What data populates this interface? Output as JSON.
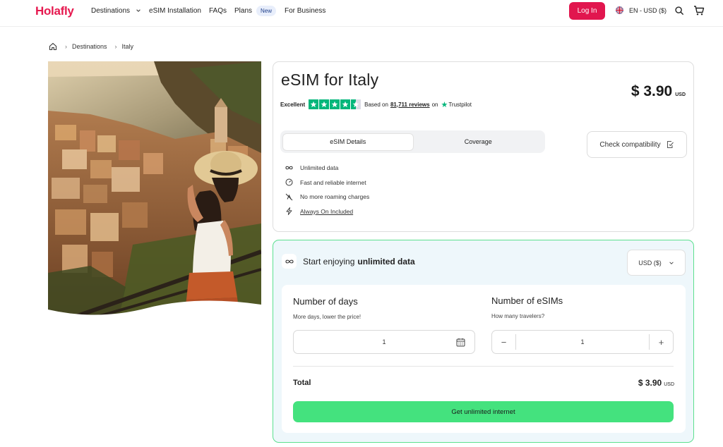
{
  "header": {
    "logo": "Holafly",
    "nav": [
      {
        "label": "Destinations"
      },
      {
        "label": "eSIM Installation"
      },
      {
        "label": "FAQs"
      },
      {
        "label": "Plans"
      },
      {
        "label": "For Business"
      }
    ],
    "plans_badge": "New",
    "login_label": "Log In",
    "language": "EN - USD ($)"
  },
  "breadcrumb": {
    "items": [
      "Destinations",
      "Italy"
    ]
  },
  "product": {
    "title": "eSIM for Italy",
    "rating_label": "Excellent",
    "stars": 4.5,
    "based_on": "Based on",
    "reviews": "81,711 reviews",
    "on": "on",
    "trustpilot": "Trustpilot",
    "price": "$ 3.90",
    "currency": "USD",
    "tabs": [
      "eSIM Details",
      "Coverage"
    ],
    "check_compat": "Check compatibility",
    "features": [
      {
        "icon": "infinity-icon",
        "label": "Unlimited data"
      },
      {
        "icon": "speedometer-icon",
        "label": "Fast and reliable internet"
      },
      {
        "icon": "no-roaming-icon",
        "label": "No more roaming charges"
      },
      {
        "icon": "lightning-icon",
        "label": "Always On Included"
      }
    ]
  },
  "purchase": {
    "heading_prefix": "Start enjoying",
    "heading_bold": "unlimited data",
    "currency_select": "USD ($)",
    "days_label": "Number of days",
    "days_sub": "More days, lower the price!",
    "days_value": "1",
    "esims_label": "Number of eSIMs",
    "esims_sub": "How many travelers?",
    "esims_value": "1",
    "minus": "−",
    "plus": "+",
    "total_label": "Total",
    "total_amount": "$ 3.90",
    "total_currency": "USD",
    "cta": "Get unlimited internet"
  },
  "colors": {
    "brand": "#e1164e",
    "cta": "#44e27e",
    "trustpilot": "#00b67a",
    "panel_bg": "#eef7fb",
    "panel_border": "#5ce08f"
  }
}
